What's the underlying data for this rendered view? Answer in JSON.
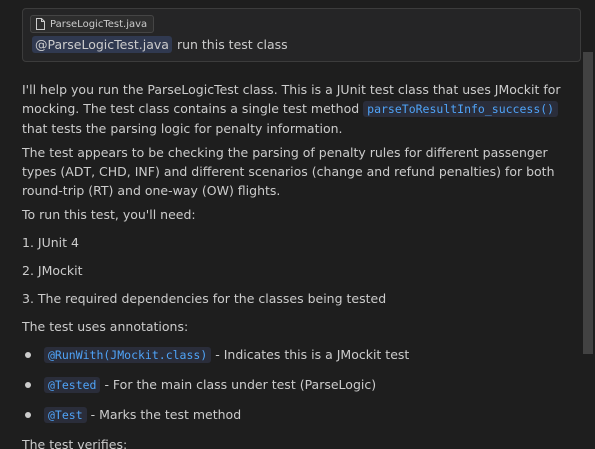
{
  "prompt": {
    "file_chip_label": "ParseLogicTest.java",
    "file_chip_icon": "file-icon",
    "mention_label": "@ParseLogicTest.java",
    "text": "run this test class"
  },
  "response": {
    "p1_text1": "I'll help you run the ParseLogicTest class. This is a JUnit test class that uses JMockit for mocking. The test class contains a single test method",
    "p1_code": "parseToResultInfo_success()",
    "p1_text2": "that tests the parsing logic for penalty information.",
    "p2": "The test appears to be checking the parsing of penalty rules for different passenger types (ADT, CHD, INF) and different scenarios (change and refund penalties) for both round-trip (RT) and one-way (OW) flights.",
    "p3": "To run this test, you'll need:",
    "needs": [
      "1. JUnit 4",
      "2. JMockit",
      "3. The required dependencies for the classes being tested"
    ],
    "p4": "The test uses annotations:",
    "annotations": [
      {
        "code": "@RunWith(JMockit.class)",
        "text": "- Indicates this is a JMockit test"
      },
      {
        "code": "@Tested",
        "text": "- For the main class under test (ParseLogic)"
      },
      {
        "code": "@Test",
        "text": "- Marks the test method"
      }
    ],
    "p5": "The test verifies:"
  },
  "colors": {
    "background": "#1e1e1e",
    "code": "#4fa3f7",
    "text": "#cccccc"
  }
}
